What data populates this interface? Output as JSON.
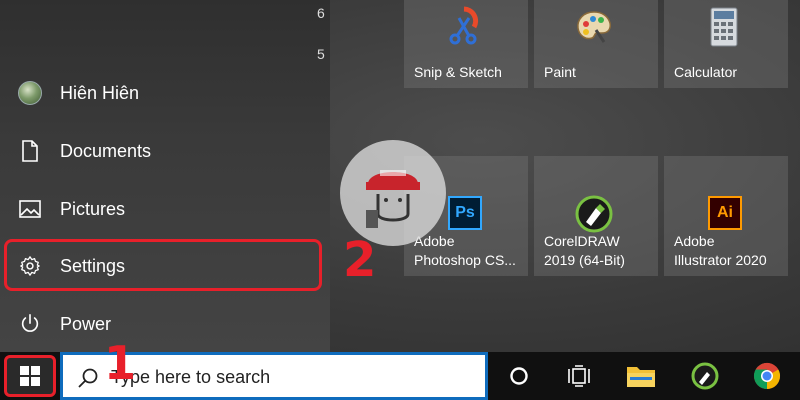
{
  "start_menu": {
    "recent_digits": [
      "6",
      "5"
    ],
    "user": {
      "name": "Hiên Hiên"
    },
    "items": [
      {
        "label": "Documents",
        "icon": "document-icon"
      },
      {
        "label": "Pictures",
        "icon": "pictures-icon"
      },
      {
        "label": "Settings",
        "icon": "gear-icon"
      },
      {
        "label": "Power",
        "icon": "power-icon"
      }
    ],
    "tiles": [
      {
        "label_lines": [
          "Snip & Sketch"
        ],
        "icon": "snip-sketch-icon"
      },
      {
        "label_lines": [
          "Paint"
        ],
        "icon": "paint-palette-icon"
      },
      {
        "label_lines": [
          "Calculator"
        ],
        "icon": "calculator-icon"
      },
      {
        "label_lines": [
          "Adobe",
          "Photoshop CS..."
        ],
        "icon": "photoshop-icon",
        "icon_text": "Ps"
      },
      {
        "label_lines": [
          "CorelDRAW",
          "2019 (64-Bit)"
        ],
        "icon": "coreldraw-icon"
      },
      {
        "label_lines": [
          "Adobe",
          "Illustrator 2020"
        ],
        "icon": "illustrator-icon",
        "icon_text": "Ai"
      }
    ]
  },
  "annotations": {
    "step1": "1",
    "step2": "2",
    "highlight_color": "#e8202a"
  },
  "taskbar": {
    "search_placeholder": "Type here to search",
    "apps": [
      "task-view-icon",
      "file-explorer-icon",
      "coreldraw-taskbar-icon",
      "chrome-icon"
    ]
  },
  "colors": {
    "accent_blue": "#0f6cbd",
    "taskbar_bg": "#101010"
  }
}
